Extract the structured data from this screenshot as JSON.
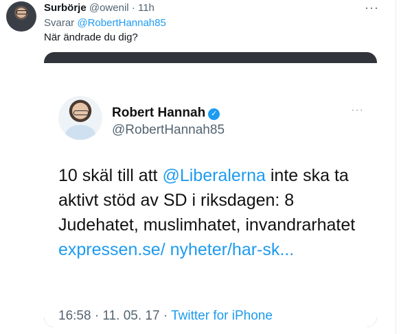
{
  "tweet": {
    "author_name": "Surbörje",
    "author_handle": "@owenil",
    "separator": " · ",
    "time": "11h",
    "more": "···",
    "reply_prefix": "Svarar ",
    "reply_to": "@RobertHannah85",
    "text": "När ändrade du dig?"
  },
  "quoted": {
    "name": "Robert Hannah",
    "handle": "@RobertHannah85",
    "verified_icon": "verified-badge-icon",
    "more": "···",
    "body": {
      "line1_pre": "10 skäl till att ",
      "mention": "@Liberalerna",
      "line1_post": " inte ska ta aktivt stöd av SD i riksdagen: 8 Judehatet, muslimhatet, invandrarhatet ",
      "link": "expressen.se/ nyheter/har-sk..."
    },
    "footer": {
      "date": "16:58 · 11. 05. 17 · ",
      "source": "Twitter for iPhone"
    }
  },
  "colors": {
    "accent": "#1d9bf0",
    "text": "#0f1419",
    "muted": "#536471",
    "card_top": "#31343b"
  }
}
